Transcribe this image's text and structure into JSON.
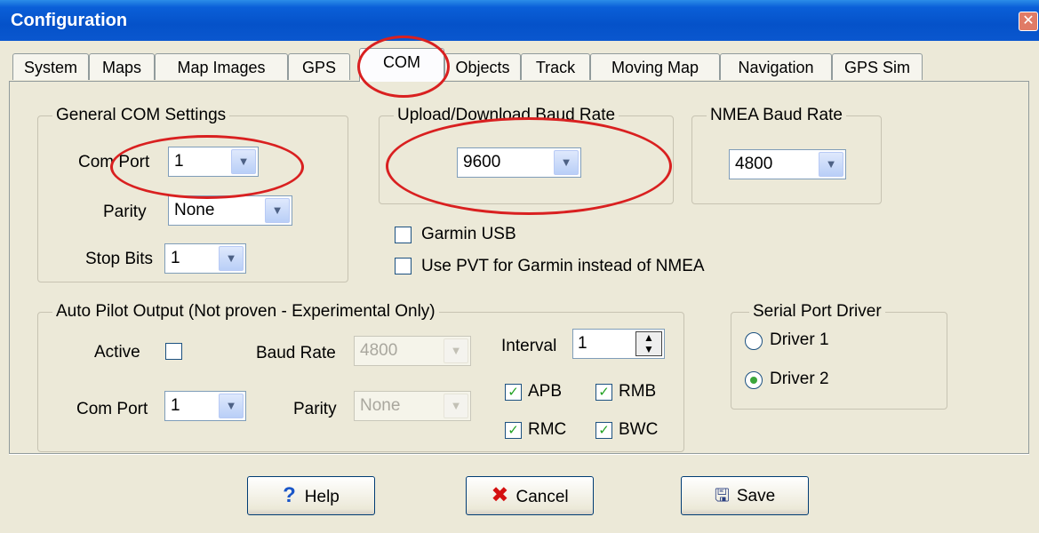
{
  "window": {
    "title": "Configuration",
    "close_glyph": "✕"
  },
  "tabs": [
    "System",
    "Maps",
    "Map Images",
    "GPS",
    "COM",
    "Objects",
    "Track",
    "Moving Map",
    "Navigation",
    "GPS Sim"
  ],
  "active_tab": "COM",
  "general": {
    "legend": "General COM Settings",
    "com_port_label": "Com Port",
    "com_port_value": "1",
    "parity_label": "Parity",
    "parity_value": "None",
    "stop_bits_label": "Stop Bits",
    "stop_bits_value": "1"
  },
  "upload": {
    "legend": "Upload/Download Baud Rate",
    "value": "9600"
  },
  "nmea": {
    "legend": "NMEA Baud Rate",
    "value": "4800"
  },
  "garmin_usb": {
    "label": "Garmin USB",
    "checked": false
  },
  "use_pvt": {
    "label": "Use PVT for Garmin instead of NMEA",
    "checked": false
  },
  "autopilot": {
    "legend": "Auto Pilot Output  (Not proven - Experimental Only)",
    "active_label": "Active",
    "baud_label": "Baud Rate",
    "baud_value": "4800",
    "interval_label": "Interval",
    "interval_value": "1",
    "com_port_label": "Com Port",
    "com_port_value": "1",
    "parity_label": "Parity",
    "parity_value": "None",
    "sentences": {
      "apb": "APB",
      "rmb": "RMB",
      "rmc": "RMC",
      "bwc": "BWC"
    }
  },
  "serial_driver": {
    "legend": "Serial Port Driver",
    "driver1": "Driver 1",
    "driver2": "Driver 2",
    "selected": "Driver 2"
  },
  "buttons": {
    "help": "Help",
    "cancel": "Cancel",
    "save": "Save"
  },
  "icons": {
    "help": "question-mark-icon",
    "cancel": "red-x-icon",
    "save": "save-disk-icon",
    "spinner": "spinner-icon"
  },
  "colors": {
    "titlebar": "#0552c9",
    "annotation": "#d92020",
    "check": "#21a121"
  }
}
